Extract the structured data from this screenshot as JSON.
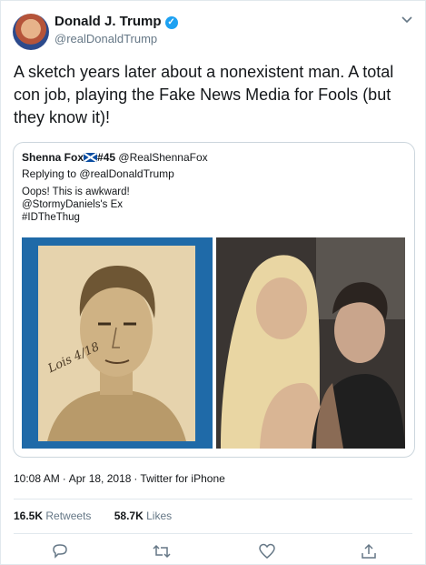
{
  "author": {
    "name": "Donald J. Trump",
    "handle": "@realDonaldTrump",
    "verified_symbol": "✓"
  },
  "tweet": {
    "text": "A sketch years later about a nonexistent man. A total con job, playing the Fake News Media for Fools (but they know it)!"
  },
  "quoted": {
    "name": "Shenna Fox",
    "name_suffix": "#45",
    "handle": "@RealShennaFox",
    "reply_prefix": "Replying to",
    "reply_to": "@realDonaldTrump",
    "text": "Oops! This is awkward!\n@StormyDaniels's Ex\n#IDTheThug",
    "signature": "Lois 4/18"
  },
  "meta": {
    "time": "10:08 AM",
    "date": "Apr 18, 2018",
    "source": "Twitter for iPhone"
  },
  "stats": {
    "retweets_count": "16.5K",
    "retweets_label": "Retweets",
    "likes_count": "58.7K",
    "likes_label": "Likes"
  },
  "icons": [
    "reply-icon",
    "retweet-icon",
    "like-icon",
    "share-icon",
    "chevron-down-icon",
    "verified-badge-icon"
  ],
  "colors": {
    "verified": "#1da1f2",
    "secondary_text": "#657786",
    "border": "#e1e8ed"
  }
}
